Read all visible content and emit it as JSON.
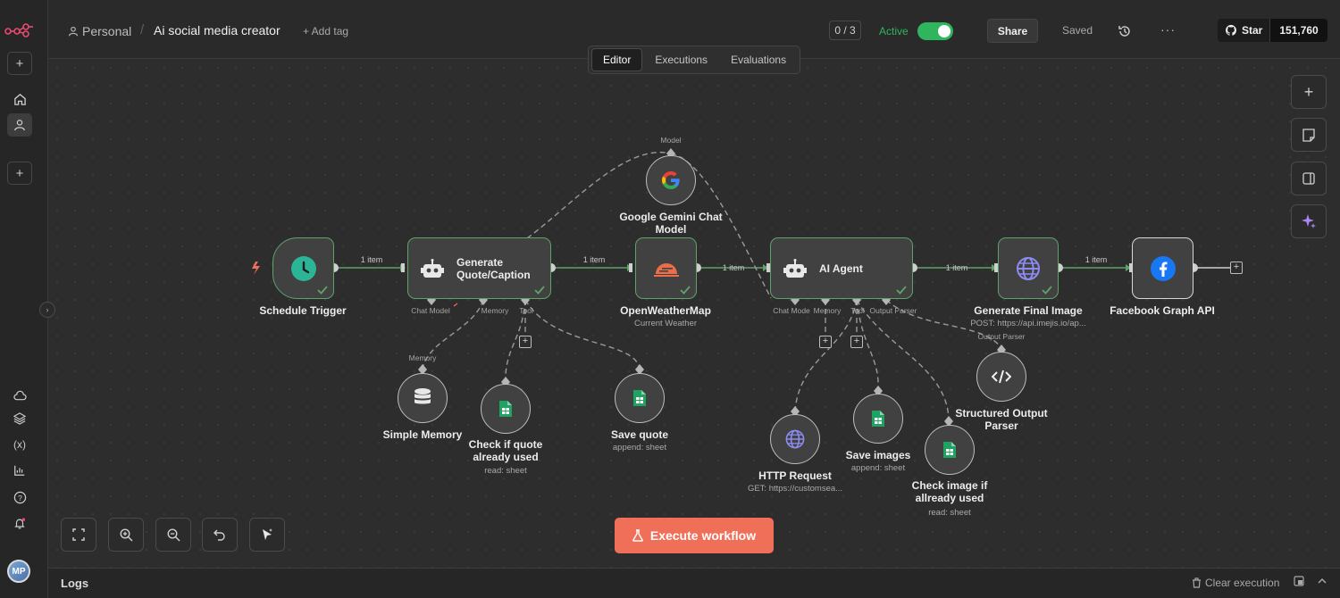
{
  "app": {
    "window_title": "n8n"
  },
  "header": {
    "breadcrumb_project": "Personal",
    "breadcrumb_separator": "/",
    "workflow_name": "Ai social media creator",
    "add_tag_label": "+ Add tag",
    "counter": "0 / 3",
    "active_label": "Active",
    "active_state": true,
    "share_label": "Share",
    "saved_label": "Saved",
    "more_label": "···",
    "github_star_label": "Star",
    "github_star_count": "151,760"
  },
  "tabs": [
    {
      "label": "Editor",
      "selected": true
    },
    {
      "label": "Executions",
      "selected": false
    },
    {
      "label": "Evaluations",
      "selected": false
    }
  ],
  "sidebar": {
    "avatar_initials": "MP",
    "items": [
      "add",
      "home",
      "personal",
      "add-project",
      "cloud",
      "templates",
      "variables",
      "insights",
      "help",
      "notifications"
    ]
  },
  "workflow": {
    "nodes": {
      "schedule": {
        "title": "Schedule Trigger"
      },
      "generate_quote": {
        "title_line1": "Generate",
        "title_line2": "Quote/Caption",
        "port_chat_model": "Chat Model",
        "port_memory": "Memory",
        "port_tool": "Tool"
      },
      "openweather": {
        "title": "OpenWeatherMap",
        "subtitle": "Current Weather"
      },
      "gemini": {
        "title_line1": "Google Gemini Chat",
        "title_line2": "Model",
        "port_model": "Model"
      },
      "ai_agent": {
        "title": "AI Agent",
        "port_chat_model": "Chat Mode",
        "port_memory": "Memory",
        "port_tool": "Tool",
        "port_output_parser": "Output Parser"
      },
      "generate_image": {
        "title": "Generate Final Image",
        "subtitle": "POST: https://api.imejis.io/ap..."
      },
      "facebook": {
        "title": "Facebook Graph API"
      },
      "simple_memory": {
        "title": "Simple Memory",
        "port_memory": "Memory"
      },
      "check_quote": {
        "title_line1": "Check if quote",
        "title_line2": "already used",
        "subtitle": "read: sheet"
      },
      "save_quote": {
        "title": "Save quote",
        "subtitle": "append: sheet"
      },
      "http_request": {
        "title": "HTTP Request",
        "subtitle": "GET: https://customsea..."
      },
      "save_images": {
        "title": "Save images",
        "subtitle": "append: sheet"
      },
      "check_image": {
        "title_line1": "Check image if",
        "title_line2": "allready used",
        "subtitle": "read: sheet"
      },
      "structured_output": {
        "title_line1": "Structured Output",
        "title_line2": "Parser",
        "port_output_parser": "Output Parser"
      }
    },
    "edge_label": "1 item"
  },
  "execute_button": {
    "label": "Execute workflow",
    "color": "#ef6f58"
  },
  "logs": {
    "label": "Logs",
    "clear_label": "Clear execution"
  },
  "colors": {
    "success_border": "#5ea36a",
    "active_green": "#2fb55d",
    "canvas_bg": "#2d2d2d"
  }
}
